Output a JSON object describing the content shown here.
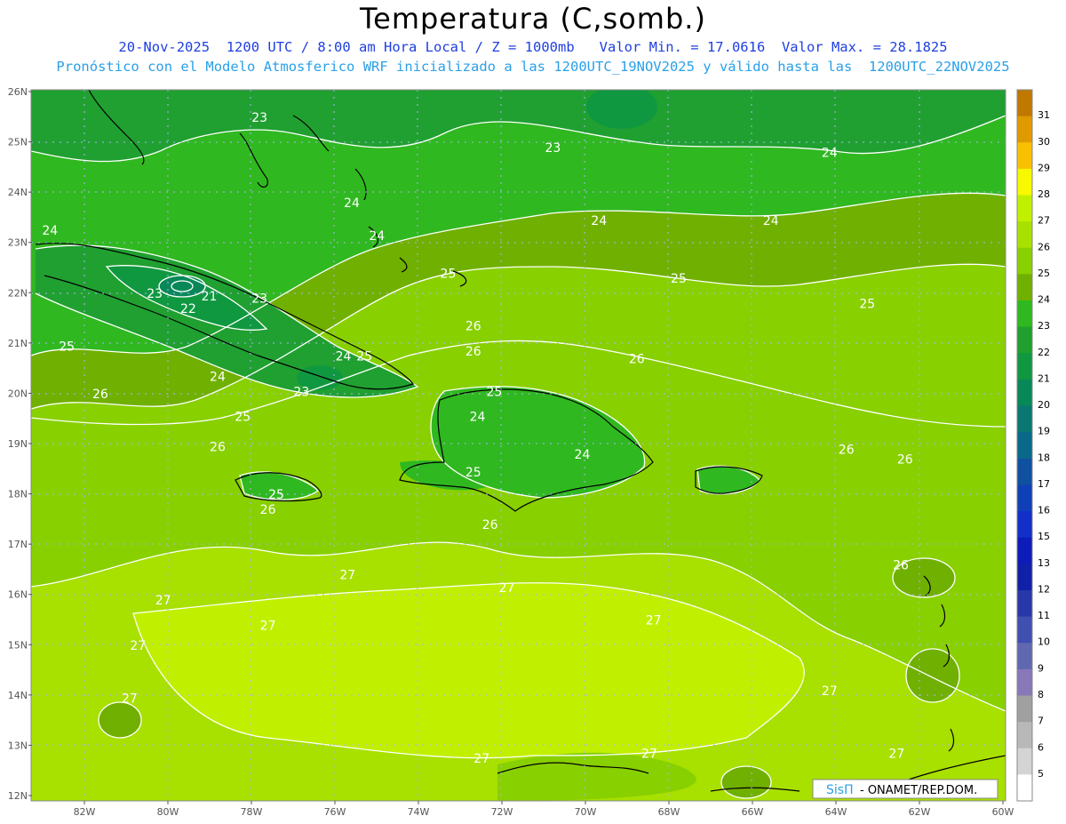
{
  "header": {
    "title": "Temperatura (C,somb.)",
    "line1": "20-Nov-2025  1200 UTC / 8:00 am Hora Local / Z = 1000mb   Valor Min. = 17.0616  Valor Max. = 28.1825",
    "line2": "Pronóstico con el Modelo Atmosferico WRF inicializado a las 1200UTC_19NOV2025 y válido hasta las  1200UTC_22NOV2025"
  },
  "axes": {
    "lat_labels": [
      "26N",
      "25N",
      "24N",
      "23N",
      "22N",
      "21N",
      "20N",
      "19N",
      "18N",
      "17N",
      "16N",
      "15N",
      "14N",
      "13N",
      "12N"
    ],
    "lon_labels": [
      "82W",
      "80W",
      "78W",
      "76W",
      "74W",
      "72W",
      "70W",
      "68W",
      "66W",
      "64W",
      "62W",
      "60W"
    ]
  },
  "colorbar": {
    "labels": [
      "31",
      "30",
      "29",
      "28",
      "27",
      "26",
      "25",
      "24",
      "23",
      "22",
      "21",
      "20",
      "19",
      "18",
      "17",
      "16",
      "15",
      "13",
      "12",
      "11",
      "10",
      "9",
      "8",
      "7",
      "6",
      "5"
    ],
    "colors": [
      "#c07800",
      "#e09a00",
      "#f8c000",
      "#f8f800",
      "#c0f000",
      "#a8e000",
      "#88d000",
      "#70b000",
      "#30b820",
      "#20a030",
      "#109840",
      "#088858",
      "#087870",
      "#0a6888",
      "#1050a0",
      "#1040b8",
      "#1030c8",
      "#0c1cb8",
      "#1020a8",
      "#2838a8",
      "#4050b0",
      "#6068b0",
      "#8878b8",
      "#a0a0a0",
      "#b8b8b8",
      "#d4d4d4",
      "#ffffff"
    ]
  },
  "contour_labels": [
    {
      "text": "23",
      "lon": -77.8,
      "lat": 25.4
    },
    {
      "text": "23",
      "lon": -70.8,
      "lat": 24.8
    },
    {
      "text": "24",
      "lon": -64.2,
      "lat": 24.7
    },
    {
      "text": "24",
      "lon": -75.6,
      "lat": 23.7
    },
    {
      "text": "24",
      "lon": -69.7,
      "lat": 23.35
    },
    {
      "text": "24",
      "lon": -65.6,
      "lat": 23.35
    },
    {
      "text": "24",
      "lon": -82.8,
      "lat": 23.15
    },
    {
      "text": "24",
      "lon": -75.0,
      "lat": 23.05
    },
    {
      "text": "25",
      "lon": -73.3,
      "lat": 22.3
    },
    {
      "text": "25",
      "lon": -67.8,
      "lat": 22.2
    },
    {
      "text": "25",
      "lon": -63.3,
      "lat": 21.7
    },
    {
      "text": "23",
      "lon": -80.3,
      "lat": 21.9
    },
    {
      "text": "21",
      "lon": -79.0,
      "lat": 21.85
    },
    {
      "text": "23",
      "lon": -77.8,
      "lat": 21.8
    },
    {
      "text": "22",
      "lon": -79.5,
      "lat": 21.6
    },
    {
      "text": "26",
      "lon": -72.7,
      "lat": 21.25
    },
    {
      "text": "26",
      "lon": -72.7,
      "lat": 20.75
    },
    {
      "text": "26",
      "lon": -68.8,
      "lat": 20.6
    },
    {
      "text": "25",
      "lon": -82.4,
      "lat": 20.85
    },
    {
      "text": "24",
      "lon": -75.8,
      "lat": 20.65
    },
    {
      "text": "25",
      "lon": -75.3,
      "lat": 20.65
    },
    {
      "text": "24",
      "lon": -78.8,
      "lat": 20.25
    },
    {
      "text": "23",
      "lon": -76.8,
      "lat": 19.95
    },
    {
      "text": "25",
      "lon": -72.2,
      "lat": 19.95
    },
    {
      "text": "26",
      "lon": -81.6,
      "lat": 19.9
    },
    {
      "text": "25",
      "lon": -78.2,
      "lat": 19.45
    },
    {
      "text": "24",
      "lon": -72.6,
      "lat": 19.45
    },
    {
      "text": "26",
      "lon": -78.8,
      "lat": 18.85
    },
    {
      "text": "24",
      "lon": -70.1,
      "lat": 18.7
    },
    {
      "text": "26",
      "lon": -63.8,
      "lat": 18.8
    },
    {
      "text": "26",
      "lon": -62.4,
      "lat": 18.6
    },
    {
      "text": "25",
      "lon": -72.7,
      "lat": 18.35
    },
    {
      "text": "25",
      "lon": -77.4,
      "lat": 17.9
    },
    {
      "text": "26",
      "lon": -77.6,
      "lat": 17.6
    },
    {
      "text": "26",
      "lon": -72.3,
      "lat": 17.3
    },
    {
      "text": "27",
      "lon": -75.7,
      "lat": 16.3
    },
    {
      "text": "26",
      "lon": -62.5,
      "lat": 16.5
    },
    {
      "text": "27",
      "lon": -71.9,
      "lat": 16.05
    },
    {
      "text": "27",
      "lon": -80.1,
      "lat": 15.8
    },
    {
      "text": "27",
      "lon": -77.6,
      "lat": 15.3
    },
    {
      "text": "27",
      "lon": -68.4,
      "lat": 15.4
    },
    {
      "text": "27",
      "lon": -80.7,
      "lat": 14.9
    },
    {
      "text": "27",
      "lon": -64.2,
      "lat": 14.0
    },
    {
      "text": "27",
      "lon": -80.9,
      "lat": 13.85
    },
    {
      "text": "27",
      "lon": -72.5,
      "lat": 12.65
    },
    {
      "text": "27",
      "lon": -68.5,
      "lat": 12.75
    },
    {
      "text": "27",
      "lon": -62.6,
      "lat": 12.75
    }
  ],
  "credit": {
    "brand": "SisΠ",
    "text": " - ONAMET/REP.DOM."
  }
}
